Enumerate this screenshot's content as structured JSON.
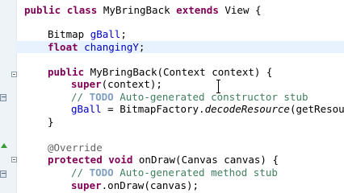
{
  "editor": {
    "lines": {
      "l1": {
        "kw1": "public",
        "kw2": "class",
        "name": " MyBringBack ",
        "kw3": "extends",
        "rest": " View {"
      },
      "l2": {
        "type": "Bitmap ",
        "field": "gBall",
        "rest": ";"
      },
      "l3": {
        "kw": "float",
        "field": "changingY",
        "rest": ";"
      },
      "l4": {
        "kw": "public",
        "rest": " MyBringBack(Context context) {"
      },
      "l5": {
        "kw": "super",
        "rest": "(context);"
      },
      "l6": {
        "pre": "// ",
        "tag": "TODO",
        "rest": " Auto-generated constructor stub"
      },
      "l7": {
        "field": "gBall",
        "mid": " = BitmapFactory.",
        "meth": "decodeResource",
        "rest": "(getResource"
      },
      "l8": {
        "text": "}"
      },
      "l9": {
        "text": "@Override"
      },
      "l10": {
        "kw1": "protected",
        "kw2": "void",
        "rest": " onDraw(Canvas canvas) {"
      },
      "l11": {
        "pre": "// ",
        "tag": "TODO",
        "rest": " Auto-generated method stub"
      },
      "l12": {
        "kw": "super",
        "rest": ".onDraw(canvas);"
      }
    },
    "colors": {
      "keyword": "#7f0055",
      "field": "#0000c0",
      "comment": "#3f7f5f",
      "todo_tag": "#7f9fbf",
      "annotation": "#646464",
      "current_line": "#e8f2fe"
    },
    "icons": [
      "fold-toggle-icon",
      "todo-marker-icon",
      "override-marker-icon",
      "text-cursor-icon"
    ]
  }
}
